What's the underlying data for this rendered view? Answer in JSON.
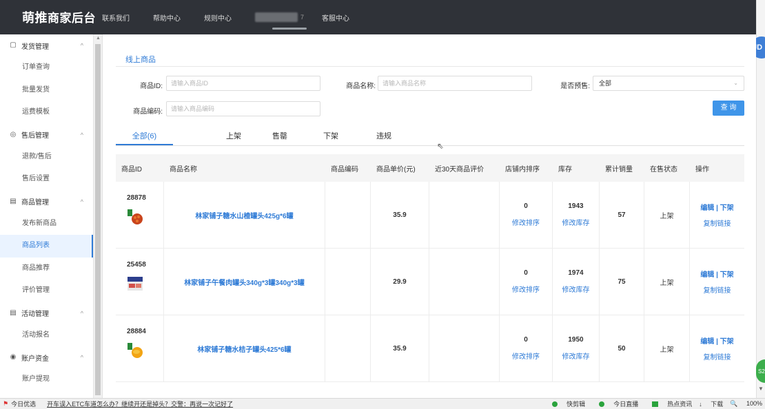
{
  "header": {
    "logo_brand": "萌推",
    "logo_text": "商家后台",
    "nav": [
      "联系我们",
      "帮助中心",
      "规则中心"
    ],
    "nav_hidden_suffix": "7",
    "nav_service": "客服中心"
  },
  "badges": {
    "jd": "JD",
    "green": "S2"
  },
  "sidebar": {
    "groups": [
      {
        "icon": "shipping-icon",
        "glyph": "▢",
        "label": "发货管理",
        "items": [
          "订单查询",
          "批量发货",
          "运费模板"
        ]
      },
      {
        "icon": "aftersale-icon",
        "glyph": "◎",
        "label": "售后管理",
        "items": [
          "退款/售后",
          "售后设置"
        ]
      },
      {
        "icon": "product-icon",
        "glyph": "▤",
        "label": "商品管理",
        "items": [
          "发布新商品",
          "商品列表",
          "商品推荐",
          "评价管理"
        ]
      },
      {
        "icon": "activity-icon",
        "glyph": "▤",
        "label": "活动管理",
        "items": [
          "活动报名"
        ]
      },
      {
        "icon": "account-icon",
        "glyph": "◉",
        "label": "账户资金",
        "items": [
          "账户提现"
        ]
      }
    ],
    "active_item": "商品列表"
  },
  "main": {
    "page_tab": "线上商品",
    "filters": {
      "product_id_label": "商品ID:",
      "product_id_placeholder": "请输入商品ID",
      "product_name_label": "商品名称:",
      "product_name_placeholder": "请输入商品名称",
      "presale_label": "是否预售:",
      "presale_value": "全部",
      "product_code_label": "商品编码:",
      "product_code_placeholder": "请输入商品编码",
      "query_button": "查 询"
    },
    "tabs": [
      "全部(6)",
      "上架",
      "售罄",
      "下架",
      "违规"
    ],
    "table": {
      "headers": [
        "商品ID",
        "商品名称",
        "商品编码",
        "商品单价(元)",
        "近30天商品评价",
        "店铺内排序",
        "库存",
        "累计销量",
        "在售状态",
        "操作"
      ],
      "rows": [
        {
          "id": "28878",
          "name": "林家铺子糖水山楂罐头425g*6罐",
          "code": "",
          "price": "35.9",
          "review": "",
          "rank": "0",
          "rank_link": "修改排序",
          "stock": "1943",
          "stock_link": "修改库存",
          "sales": "57",
          "status": "上架",
          "op_edit": "编辑 | 下架",
          "op_copy": "复制链接",
          "thumb": "hawthorn"
        },
        {
          "id": "25458",
          "name": "林家铺子午餐肉罐头340g*3罐340g*3罐",
          "code": "",
          "price": "29.9",
          "review": "",
          "rank": "0",
          "rank_link": "修改排序",
          "stock": "1974",
          "stock_link": "修改库存",
          "sales": "75",
          "status": "上架",
          "op_edit": "编辑 | 下架",
          "op_copy": "复制链接",
          "thumb": "luncheon"
        },
        {
          "id": "28884",
          "name": "林家铺子糖水桔子罐头425*6罐",
          "code": "",
          "price": "35.9",
          "review": "",
          "rank": "0",
          "rank_link": "修改排序",
          "stock": "1950",
          "stock_link": "修改库存",
          "sales": "50",
          "status": "上架",
          "op_edit": "编辑 | 下架",
          "op_copy": "复制链接",
          "thumb": "orange"
        }
      ]
    }
  },
  "statusbar": {
    "left_label": "今日优选",
    "news": "开车误入ETC车道怎么办？继续开还是掉头？交警：再说一次记好了",
    "items": [
      "快剪辑",
      "今日直播",
      "热点资讯",
      "下载"
    ],
    "zoom": "100%"
  },
  "colors": {
    "accent": "#2f7bd6",
    "topbar": "#2f3238",
    "query_button": "#3f95e9"
  }
}
